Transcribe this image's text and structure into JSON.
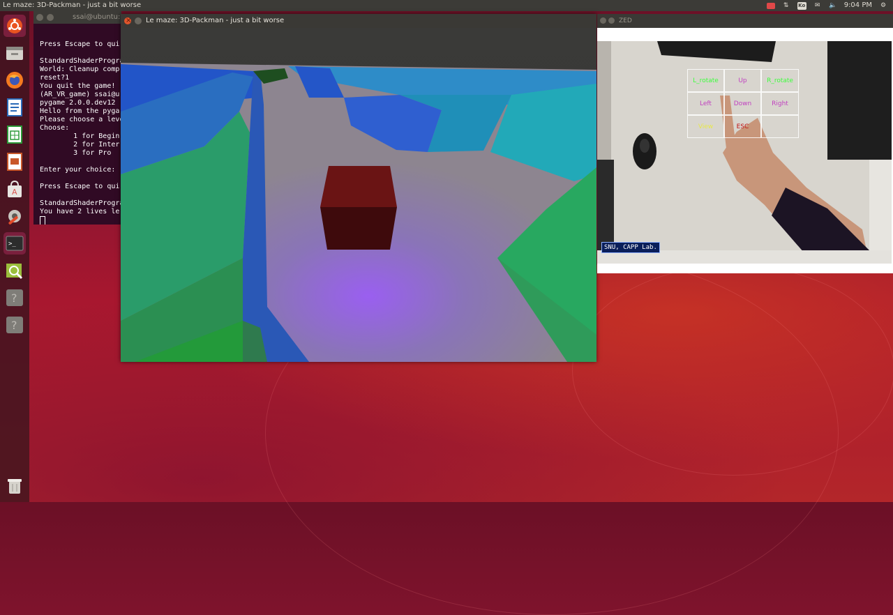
{
  "topbar": {
    "window_title": "Le maze: 3D-Packman - just a bit worse",
    "tray": {
      "keyboard_label": "Ko",
      "time": "9:04 PM"
    }
  },
  "launcher": {
    "items": [
      {
        "name": "ubuntu-dash-icon"
      },
      {
        "name": "file-manager-icon"
      },
      {
        "name": "firefox-icon"
      },
      {
        "name": "libreoffice-writer-icon"
      },
      {
        "name": "libreoffice-calc-icon"
      },
      {
        "name": "libreoffice-impress-icon"
      },
      {
        "name": "software-center-icon"
      },
      {
        "name": "settings-icon"
      },
      {
        "name": "terminal-icon"
      },
      {
        "name": "image-viewer-icon"
      },
      {
        "name": "unknown-app-icon"
      },
      {
        "name": "unknown-app-icon"
      },
      {
        "name": "trash-icon"
      }
    ]
  },
  "terminal": {
    "title": "ssai@ubuntu:",
    "lines": [
      "",
      "Press Escape to qui",
      "",
      "StandardShaderProgra",
      "World: Cleanup comp",
      "reset?1",
      "You quit the game!",
      "(AR_VR_game) ssai@u",
      "pygame 2.0.0.dev12",
      "Hello from the pyga",
      "Please choose a leve",
      "Choose:",
      "        1 for Begin",
      "        2 for Inter",
      "        3 for Pro",
      "",
      "Enter your choice: ",
      "",
      "Press Escape to qui",
      "",
      "StandardShaderProgra",
      "You have 2 lives le"
    ]
  },
  "game": {
    "title": "Le maze: 3D-Packman - just a bit worse"
  },
  "zed": {
    "title": "ZED",
    "grid": [
      {
        "label": "L_rotate",
        "color": "#3cff3c"
      },
      {
        "label": "Up",
        "color": "#c040c0"
      },
      {
        "label": "R_rotate",
        "color": "#3cff3c"
      },
      {
        "label": "Left",
        "color": "#c040c0"
      },
      {
        "label": "Down",
        "color": "#c040c0"
      },
      {
        "label": "Right",
        "color": "#c040c0"
      },
      {
        "label": "View",
        "color": "#e8e84a"
      },
      {
        "label": "ESC",
        "color": "#c01010"
      },
      {
        "label": "",
        "color": "#ffffff"
      }
    ],
    "badge": "SNU, CAPP Lab."
  },
  "colors": {
    "topbar": "#3c3b37",
    "terminal_bg": "#300a24",
    "accent_close": "#e1552c"
  }
}
